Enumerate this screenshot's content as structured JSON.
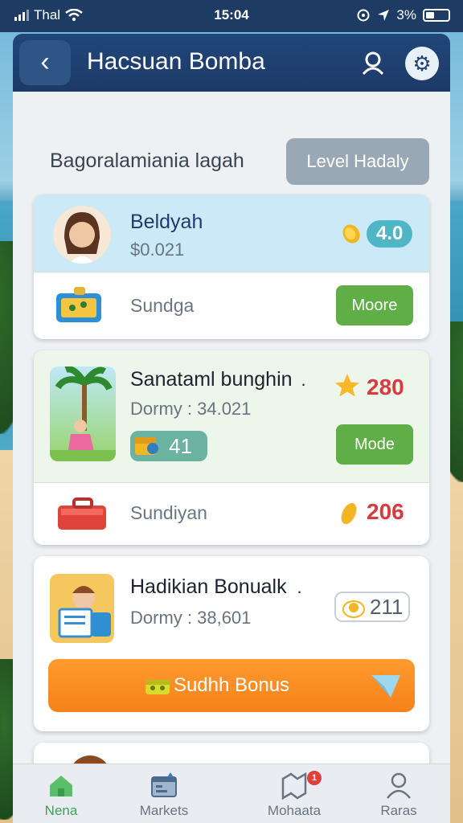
{
  "status_bar": {
    "carrier": "Thal",
    "time": "15:04",
    "battery": "3%"
  },
  "header": {
    "title": "Hacsuan Bomba",
    "back_icon": "chevron-left-icon",
    "profile_icon": "user-icon",
    "settings_icon": "gear-icon"
  },
  "section": {
    "title": "Bagoralamiania lagah",
    "level_button": "Level Hadaly"
  },
  "cards": [
    {
      "name": "Beldyah",
      "sub": "$0.021",
      "badge_value": "4.0",
      "row_label": "Sundga",
      "row_button": "Moore"
    },
    {
      "name": "Sanataml bunghin",
      "name_suffix": ".",
      "sub": "Dormy : 34.021",
      "score": "280",
      "pill_value": "41",
      "row_button": "Mode",
      "row_label": "Sundiyan",
      "row_score": "206"
    },
    {
      "name": "Hadikian Bonualk",
      "name_suffix": ".",
      "sub": "Dormy : 38,601",
      "pill_value": "211",
      "cta": "Sudhh Bonus"
    }
  ],
  "bottom_nav": [
    {
      "label": "Nena",
      "icon": "home-icon",
      "active": true
    },
    {
      "label": "Markets",
      "icon": "calendar-icon",
      "active": false
    },
    {
      "label": "Mohaata",
      "icon": "map-icon",
      "active": false,
      "badge": "1"
    },
    {
      "label": "Raras",
      "icon": "user-icon",
      "active": false
    }
  ],
  "colors": {
    "header": "#1d3b63",
    "accent_green": "#5fae46",
    "accent_orange": "#f5821c",
    "score_red": "#d83a3f"
  }
}
